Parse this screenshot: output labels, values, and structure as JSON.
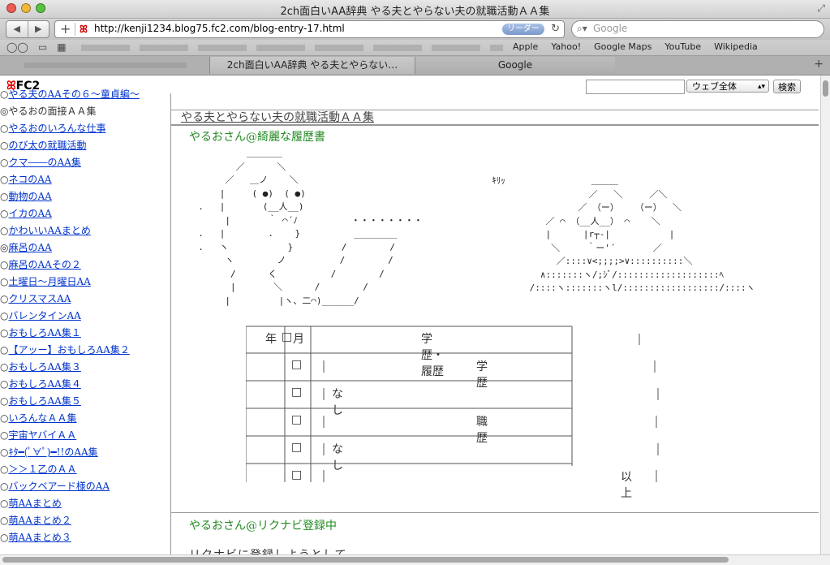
{
  "window": {
    "title": "2ch面白いAA辞典 やる夫とやらない夫の就職活動ＡＡ集"
  },
  "toolbar": {
    "back": "◀",
    "forward": "▶",
    "url": "http://kenji1234.blog75.fc2.com/blog-entry-17.html",
    "reader": "リーダー",
    "search_placeholder": "Google"
  },
  "bookmarks": [
    "Apple",
    "Yahoo!",
    "Google Maps",
    "YouTube",
    "Wikipedia"
  ],
  "tabs": [
    {
      "label": "2ch面白いAA辞典 やる夫とやらない…"
    },
    {
      "label": "Google"
    }
  ],
  "fc2": {
    "logo": "FC2",
    "select": "ウェブ全体",
    "search_button": "検索"
  },
  "sidebar": [
    {
      "bullet": "○",
      "label": "やる夫のAAその６～童貞編～",
      "link": true
    },
    {
      "bullet": "◎",
      "label": "やるおの面接ＡＡ集",
      "link": false
    },
    {
      "bullet": "○",
      "label": "やるおのいろんな仕事",
      "link": true
    },
    {
      "bullet": "○",
      "label": "のび太の就職活動",
      "link": true
    },
    {
      "bullet": "○",
      "label": "クマ――のAA集",
      "link": true
    },
    {
      "bullet": "○",
      "label": "ネコのAA",
      "link": true
    },
    {
      "bullet": "○",
      "label": "動物のAA",
      "link": true
    },
    {
      "bullet": "○",
      "label": "イカのAA",
      "link": true
    },
    {
      "bullet": "○",
      "label": "かわいいAAまとめ",
      "link": true
    },
    {
      "bullet": "◎",
      "label": "麻呂のAA",
      "link": true
    },
    {
      "bullet": "○",
      "label": "麻呂のAAその２",
      "link": true
    },
    {
      "bullet": "○",
      "label": "土曜日～月曜日AA",
      "link": true
    },
    {
      "bullet": "○",
      "label": "クリスマスAA",
      "link": true
    },
    {
      "bullet": "○",
      "label": "バレンタインAA",
      "link": true
    },
    {
      "bullet": "○",
      "label": "おもしろAA集１",
      "link": true
    },
    {
      "bullet": "○",
      "label": "【アッー】おもしろAA集２",
      "link": true
    },
    {
      "bullet": "○",
      "label": "おもしろAA集３",
      "link": true
    },
    {
      "bullet": "○",
      "label": "おもしろAA集４",
      "link": true
    },
    {
      "bullet": "○",
      "label": "おもしろAA集５",
      "link": true
    },
    {
      "bullet": "○",
      "label": "いろんなＡＡ集",
      "link": true
    },
    {
      "bullet": "○",
      "label": "宇宙ヤバイＡＡ",
      "link": true
    },
    {
      "bullet": "○",
      "label": "ｷﾀ━(ﾟ∀ﾟ)━!!のAA集",
      "link": true
    },
    {
      "bullet": "○",
      "label": "＞＞１乙のＡＡ",
      "link": true
    },
    {
      "bullet": "○",
      "label": "バックベアード様のAA",
      "link": true
    },
    {
      "bullet": "○",
      "label": "萌AAまとめ",
      "link": true
    },
    {
      "bullet": "○",
      "label": "萌AAまとめ２",
      "link": true
    },
    {
      "bullet": "○",
      "label": "萌AAまとめ３",
      "link": true
    }
  ],
  "content": {
    "header": "やる夫とやらない夫の就職活動ＡＡ集",
    "section1_title": "やるおさん@綺麗な履歴書",
    "aa_left": "           ＿＿＿＿\n         ／      ＼\n       ／   ＿ノ    ＼\n      |     ( ●)  ( ●)\n  .   |       (__人__)\n       |       ｀ ⌒´ﾉ          ・・・・・・・・\n  .   |        .    }          ________\n  .   ヽ           }         /        /\n       ヽ        ノ          /        /\n        /      く          /        /\n        |       ＼      /        /\n       |         |ヽ、二⌒)______/",
    "aa_right": "  ｷﾘｯ                ＿＿＿\n                    ／   ＼     ／＼\n                  ／ （ー）   （ー）  ＼\n            ／ ⌒ （__人__） ⌒    ＼\n            |      |r┬-|           |\n             ＼     ｀ー'´       ／\n              ／::::∨<;;;;>∨::::::::::＼\n           ∧:::::::ヽ/;ｼﾞ/:::::::::::::::::::ﾍ\n         /::::ヽ:::::::ヽl/::::::::::::::::::/::::ヽ",
    "resume": {
      "header_year": "年",
      "header_month": "月",
      "header_col": "学歴・履歴",
      "box": "□",
      "education": "学歴",
      "none1": "なし",
      "work": "職歴",
      "none2": "なし",
      "end": "以上"
    },
    "section2_title": "やるおさん@リクナビ登録中",
    "section2_body": "リクナビに登録しようとして"
  }
}
